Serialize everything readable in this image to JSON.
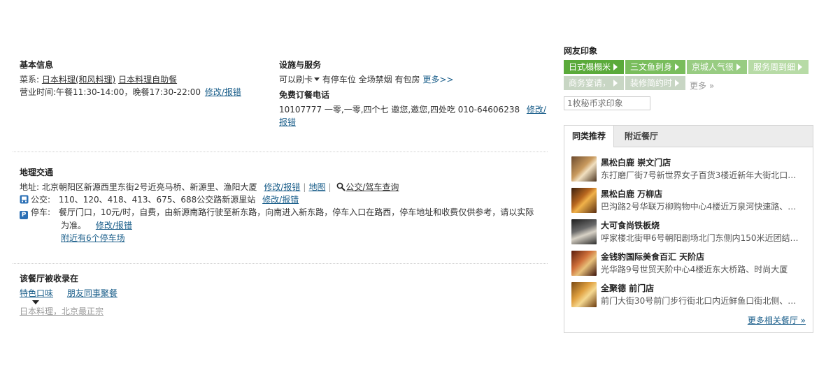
{
  "basic": {
    "title": "基本信息",
    "cuisine_label": "菜系:",
    "cuisines": [
      "日本料理(和风料理)",
      "日本料理自助餐"
    ],
    "hours_label": "营业时间:",
    "hours": "午餐11:30-14:00，晚餐17:30-22:00",
    "edit_link": "修改/报错"
  },
  "facility": {
    "title": "设施与服务",
    "card": "可以刷卡",
    "items": "有停车位 全场禁烟 有包房",
    "more": "更多>>",
    "phone_title": "免费订餐电话",
    "phone_text": "10107777 一零,一零,四个七 邀您,邀您,四处吃 010-64606238",
    "phone_edit_1": "修改/",
    "phone_edit_2": "报错"
  },
  "traffic": {
    "title": "地理交通",
    "address_label": "地址:",
    "address": "北京朝阳区新源西里东街2号近亮马桥、新源里、渔阳大厦",
    "edit_link": "修改/报错",
    "map_link": "地图",
    "bus_query_link": "公交/驾车查询",
    "bus_icon": "bus-icon",
    "bus_label": "公交:",
    "bus": "110、120、418、413、675、688公交路新源里站",
    "bus_edit": "修改/报错",
    "parking_icon_text": "P",
    "parking_label": "停车:",
    "parking_line1": "餐厅门口，10元/时，自费，由新源南路行驶至新东路，向南进入新东路，停车入口在路西，停车地址和收费仅供参考，请以实际",
    "parking_line2": "为准。",
    "parking_edit": "修改/报错",
    "nearby_parking": "附近有6个停车场"
  },
  "collected": {
    "title": "该餐厅被收录在",
    "tags": [
      "特色口味",
      "朋友同事聚餐"
    ],
    "sub": "日本料理，北京最正宗"
  },
  "impressions": {
    "title": "网友印象",
    "tags": [
      "日式榻榻米",
      "三文鱼刺身",
      "京城人气很",
      "服务周到细",
      "商务宴请，",
      "装修简约时"
    ],
    "more": "更多 »",
    "input_placeholder": "1枚秘币求印象"
  },
  "panel": {
    "tabs": [
      "同类推荐",
      "附近餐厅"
    ],
    "restaurants": [
      {
        "name": "黑松白鹿 崇文门店",
        "addr": "东打磨厂街7号新世界女子百货3楼近新年大街北口…"
      },
      {
        "name": "黑松白鹿 万柳店",
        "addr": "巴沟路2号华联万柳购物中心4楼近万泉河快速路、…"
      },
      {
        "name": "大可食尚铁板烧",
        "addr": "呼家楼北街甲6号朝阳剧场北门东侧内150米近团结…"
      },
      {
        "name": "金钱豹国际美食百汇 天阶店",
        "addr": "光华路9号世贸天阶中心4楼近东大桥路、时尚大厦"
      },
      {
        "name": "全聚德 前门店",
        "addr": "前门大街30号前门步行街北口内近鲜鱼口街北侧、…"
      }
    ],
    "more": "更多相关餐厅 »"
  },
  "colors": {
    "link": "#1a5e8a",
    "tag_green": "#5aaa3a",
    "panel_border": "#d4d4d4"
  }
}
